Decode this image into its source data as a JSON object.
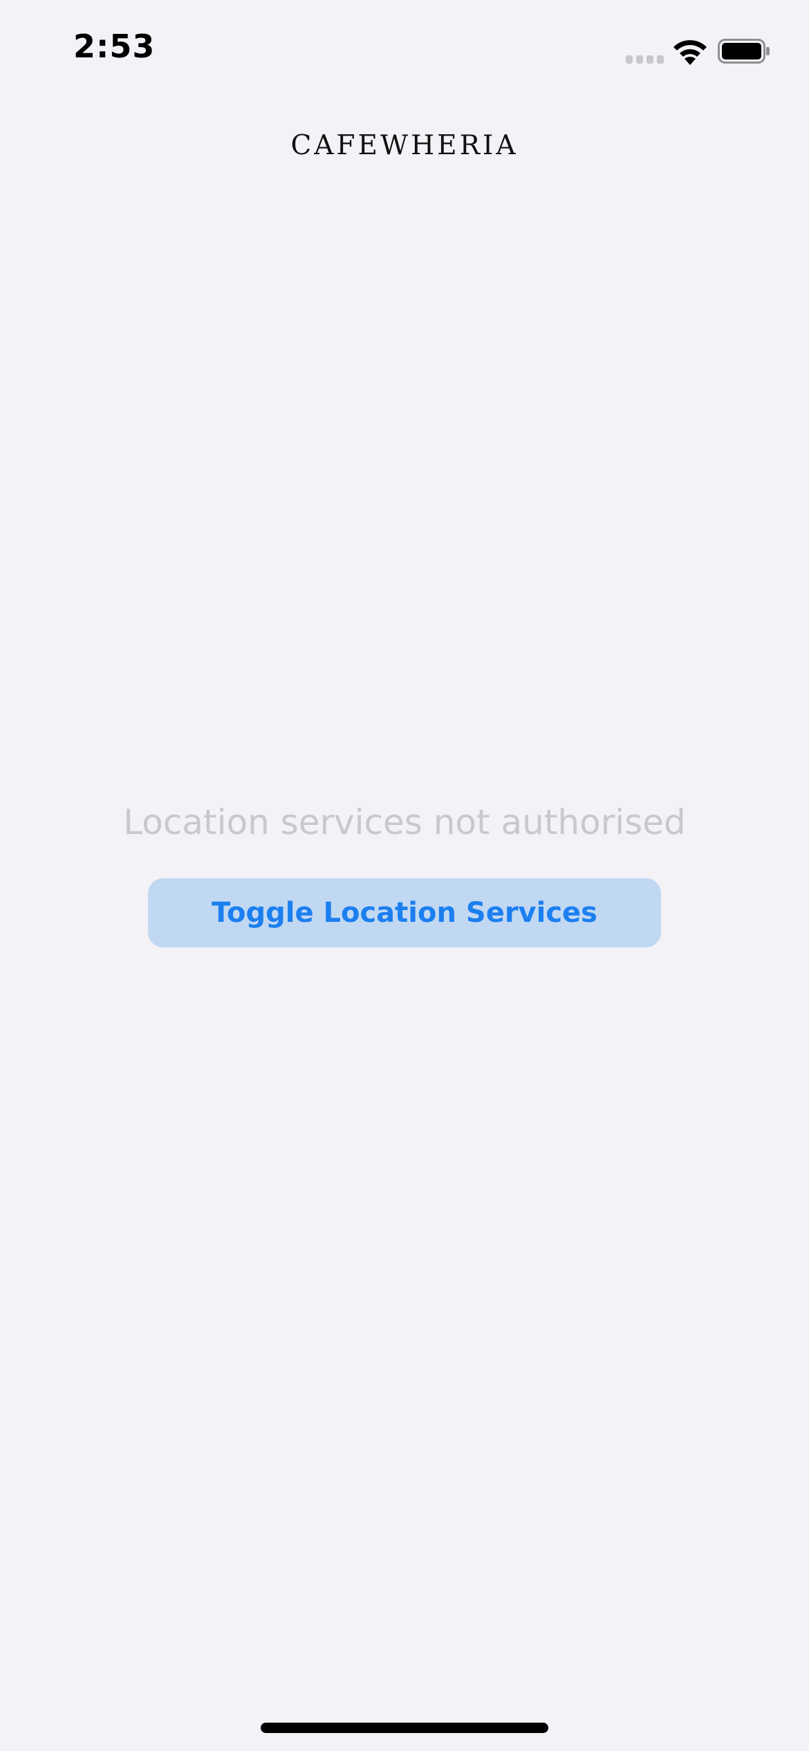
{
  "status_bar": {
    "time": "2:53",
    "signal_icon": "cellular-signal-icon",
    "wifi_icon": "wifi-icon",
    "battery_icon": "battery-icon"
  },
  "header": {
    "brand": "CAFEWHERIA"
  },
  "main": {
    "status_message": "Location services not authorised",
    "toggle_button_label": "Toggle Location Services"
  },
  "colors": {
    "background": "#f2f2f7",
    "button_background": "#c1d8f2",
    "button_text": "#1b7ff0",
    "message_text": "#c8c8cd"
  }
}
